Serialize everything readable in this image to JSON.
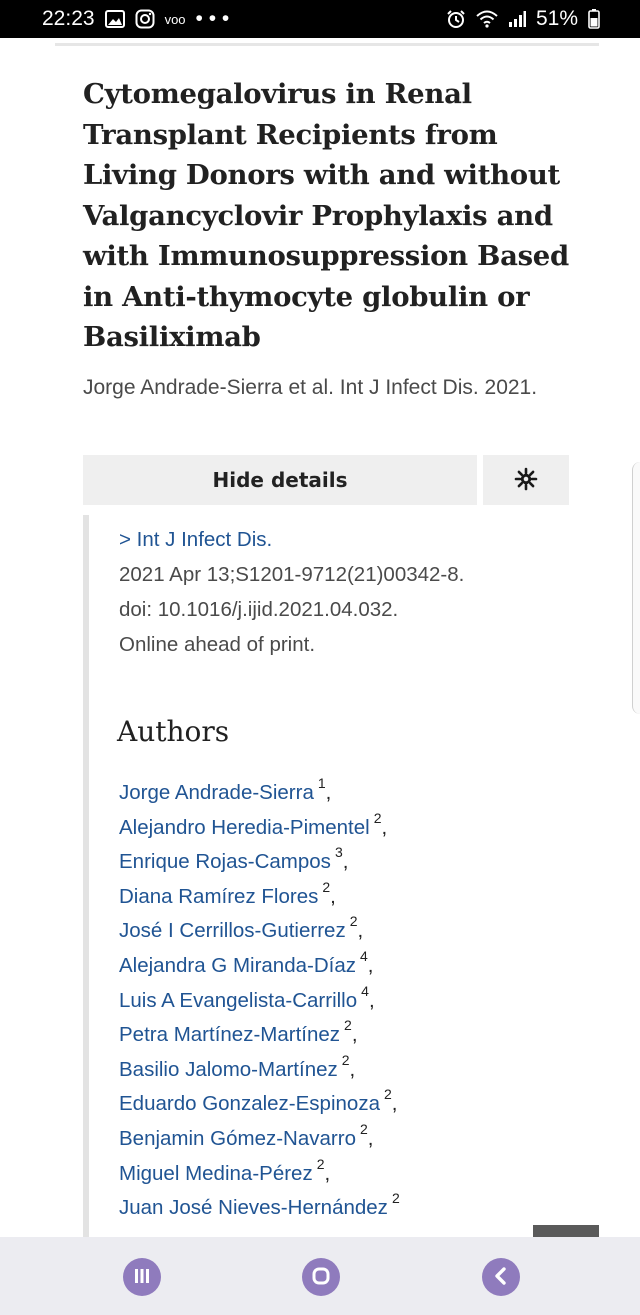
{
  "status_bar": {
    "time": "22:23",
    "extra_icons_text": "• • •",
    "battery_percent": "51%",
    "icons": [
      "gallery-icon",
      "instagram-icon",
      "voo-icon",
      "alarm-icon",
      "wifi-icon",
      "signal-icon",
      "battery-icon"
    ],
    "voo_label": "voo"
  },
  "article": {
    "title": "Cytomegalovirus in Renal Transplant Recipients from Living Donors with and without Valgancyclovir Prophylaxis and with Immunosuppression Based in Anti-thymocyte globulin or Basiliximab",
    "citation": "Jorge Andrade-Sierra et al. Int J Infect Dis. 2021."
  },
  "details": {
    "toggle_label": "Hide details",
    "settings_icon": "gear-icon",
    "journal_link": "> Int J Infect Dis.",
    "pub_lines": [
      "2021 Apr 13;S1201-9712(21)00342-8.",
      "doi: 10.1016/j.ijid.2021.04.032.",
      "Online ahead of print."
    ]
  },
  "authors": {
    "heading": "Authors",
    "list": [
      {
        "name": "Jorge Andrade-Sierra",
        "affil": "1",
        "sep": ","
      },
      {
        "name": "Alejandro Heredia-Pimentel",
        "affil": "2",
        "sep": ","
      },
      {
        "name": "Enrique Rojas-Campos",
        "affil": "3",
        "sep": ","
      },
      {
        "name": "Diana Ramírez Flores",
        "affil": "2",
        "sep": ","
      },
      {
        "name": "José I Cerrillos-Gutierrez",
        "affil": "2",
        "sep": ","
      },
      {
        "name": "Alejandra G Miranda-Díaz",
        "affil": "4",
        "sep": ","
      },
      {
        "name": "Luis A Evangelista-Carrillo",
        "affil": "4",
        "sep": ","
      },
      {
        "name": "Petra Martínez-Martínez",
        "affil": "2",
        "sep": ","
      },
      {
        "name": "Basilio Jalomo-Martínez",
        "affil": "2",
        "sep": ","
      },
      {
        "name": "Eduardo Gonzalez-Espinoza",
        "affil": "2",
        "sep": ","
      },
      {
        "name": "Benjamin Gómez-Navarro",
        "affil": "2",
        "sep": ","
      },
      {
        "name": "Miguel Medina-Pérez",
        "affil": "2",
        "sep": ","
      },
      {
        "name": "Juan José Nieves-Hernández",
        "affil": "2",
        "sep": ""
      }
    ]
  },
  "nav_bar": {
    "buttons": [
      "recent-apps-icon",
      "home-icon",
      "back-icon"
    ],
    "accent": "#8f7bbd"
  },
  "colors": {
    "link": "#205493",
    "text": "#212121",
    "muted": "#4a4a4a",
    "button_bg": "#efefef"
  }
}
